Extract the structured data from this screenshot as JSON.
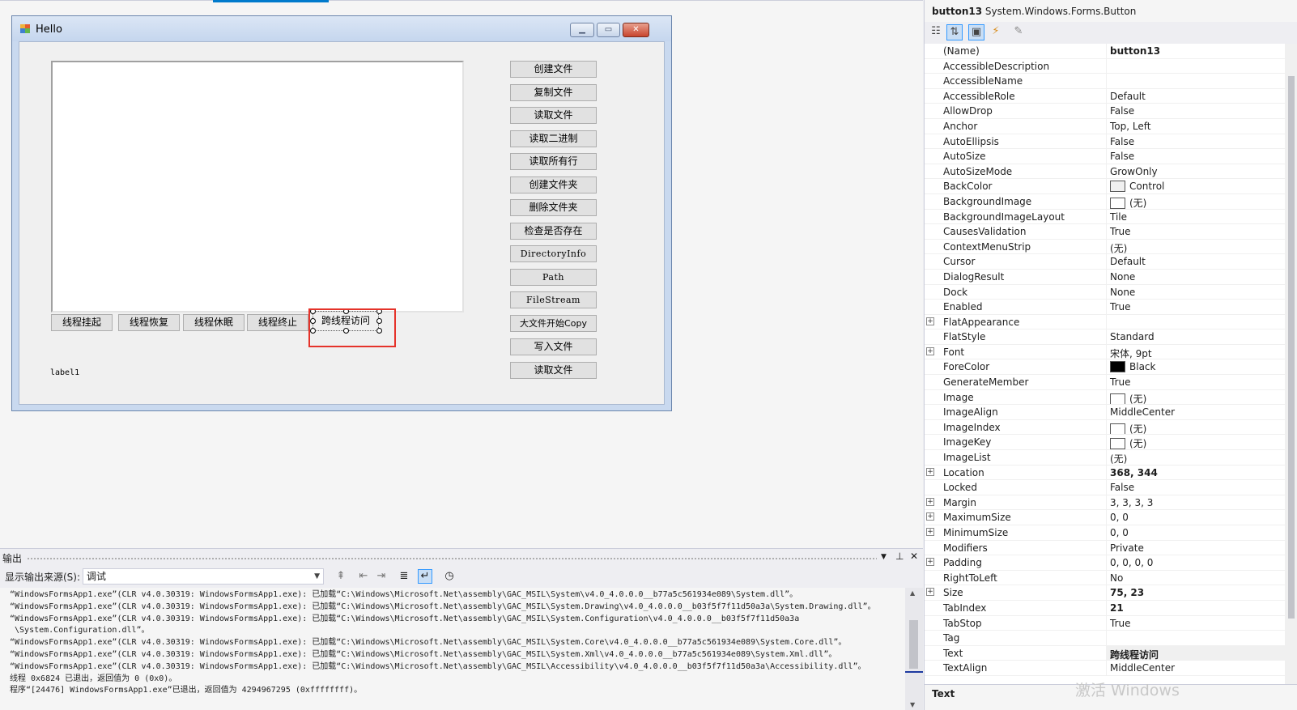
{
  "form": {
    "title": "Hello",
    "textbox_value": "",
    "right_buttons": [
      "创建文件",
      "复制文件",
      "读取文件",
      "读取二进制",
      "读取所有行",
      "创建文件夹",
      "删除文件夹",
      "检查是否存在",
      "DirectoryInfo",
      "Path",
      "FileStream",
      "大文件开始Copy",
      "写入文件",
      "读取文件"
    ],
    "bottom_buttons": [
      "线程挂起",
      "线程恢复",
      "线程休眠",
      "线程终止"
    ],
    "selected_button": "跨线程访问",
    "label": "label1"
  },
  "output": {
    "title": "输出",
    "source_label": "显示输出来源(S):",
    "source_value": "调试",
    "lines": [
      "“WindowsFormsApp1.exe”(CLR v4.0.30319: WindowsFormsApp1.exe): 已加载“C:\\Windows\\Microsoft.Net\\assembly\\GAC_MSIL\\System\\v4.0_4.0.0.0__b77a5c561934e089\\System.dll”。",
      "“WindowsFormsApp1.exe”(CLR v4.0.30319: WindowsFormsApp1.exe): 已加载“C:\\Windows\\Microsoft.Net\\assembly\\GAC_MSIL\\System.Drawing\\v4.0_4.0.0.0__b03f5f7f11d50a3a\\System.Drawing.dll”。",
      "“WindowsFormsApp1.exe”(CLR v4.0.30319: WindowsFormsApp1.exe): 已加载“C:\\Windows\\Microsoft.Net\\assembly\\GAC_MSIL\\System.Configuration\\v4.0_4.0.0.0__b03f5f7f11d50a3a",
      " \\System.Configuration.dll”。",
      "“WindowsFormsApp1.exe”(CLR v4.0.30319: WindowsFormsApp1.exe): 已加载“C:\\Windows\\Microsoft.Net\\assembly\\GAC_MSIL\\System.Core\\v4.0_4.0.0.0__b77a5c561934e089\\System.Core.dll”。",
      "“WindowsFormsApp1.exe”(CLR v4.0.30319: WindowsFormsApp1.exe): 已加载“C:\\Windows\\Microsoft.Net\\assembly\\GAC_MSIL\\System.Xml\\v4.0_4.0.0.0__b77a5c561934e089\\System.Xml.dll”。",
      "“WindowsFormsApp1.exe”(CLR v4.0.30319: WindowsFormsApp1.exe): 已加载“C:\\Windows\\Microsoft.Net\\assembly\\GAC_MSIL\\Accessibility\\v4.0_4.0.0.0__b03f5f7f11d50a3a\\Accessibility.dll”。",
      "线程 0x6824 已退出，返回值为 0 (0x0)。",
      "程序“[24476] WindowsFormsApp1.exe”已退出，返回值为 4294967295 (0xffffffff)。"
    ]
  },
  "properties": {
    "object_name": "button13",
    "object_type": "System.Windows.Forms.Button",
    "rows": [
      {
        "name": "(Name)",
        "value": "button13",
        "bold": true
      },
      {
        "name": "AccessibleDescription",
        "value": ""
      },
      {
        "name": "AccessibleName",
        "value": ""
      },
      {
        "name": "AccessibleRole",
        "value": "Default"
      },
      {
        "name": "AllowDrop",
        "value": "False"
      },
      {
        "name": "Anchor",
        "value": "Top, Left"
      },
      {
        "name": "AutoEllipsis",
        "value": "False"
      },
      {
        "name": "AutoSize",
        "value": "False"
      },
      {
        "name": "AutoSizeMode",
        "value": "GrowOnly"
      },
      {
        "name": "BackColor",
        "value": "Control",
        "swatch": "#f0f0f0"
      },
      {
        "name": "BackgroundImage",
        "value": "(无)",
        "swatch": "#ffffff"
      },
      {
        "name": "BackgroundImageLayout",
        "value": "Tile"
      },
      {
        "name": "CausesValidation",
        "value": "True"
      },
      {
        "name": "ContextMenuStrip",
        "value": "(无)"
      },
      {
        "name": "Cursor",
        "value": "Default"
      },
      {
        "name": "DialogResult",
        "value": "None"
      },
      {
        "name": "Dock",
        "value": "None"
      },
      {
        "name": "Enabled",
        "value": "True"
      },
      {
        "name": "FlatAppearance",
        "value": "",
        "expand": true
      },
      {
        "name": "FlatStyle",
        "value": "Standard"
      },
      {
        "name": "Font",
        "value": "宋体, 9pt",
        "expand": true
      },
      {
        "name": "ForeColor",
        "value": "Black",
        "swatch": "#000000"
      },
      {
        "name": "GenerateMember",
        "value": "True"
      },
      {
        "name": "Image",
        "value": "(无)",
        "swatch": "#ffffff"
      },
      {
        "name": "ImageAlign",
        "value": "MiddleCenter"
      },
      {
        "name": "ImageIndex",
        "value": "(无)",
        "swatch": "#ffffff"
      },
      {
        "name": "ImageKey",
        "value": "(无)",
        "swatch": "#ffffff"
      },
      {
        "name": "ImageList",
        "value": "(无)"
      },
      {
        "name": "Location",
        "value": "368, 344",
        "bold": true,
        "expand": true
      },
      {
        "name": "Locked",
        "value": "False"
      },
      {
        "name": "Margin",
        "value": "3, 3, 3, 3",
        "expand": true
      },
      {
        "name": "MaximumSize",
        "value": "0, 0",
        "expand": true
      },
      {
        "name": "MinimumSize",
        "value": "0, 0",
        "expand": true
      },
      {
        "name": "Modifiers",
        "value": "Private"
      },
      {
        "name": "Padding",
        "value": "0, 0, 0, 0",
        "expand": true
      },
      {
        "name": "RightToLeft",
        "value": "No"
      },
      {
        "name": "Size",
        "value": "75, 23",
        "bold": true,
        "expand": true
      },
      {
        "name": "TabIndex",
        "value": "21",
        "bold": true
      },
      {
        "name": "TabStop",
        "value": "True"
      },
      {
        "name": "Tag",
        "value": ""
      },
      {
        "name": "Text",
        "value": "跨线程访问",
        "bold": true,
        "selected": true
      },
      {
        "name": "TextAlign",
        "value": "MiddleCenter"
      }
    ],
    "description_title": "Text",
    "watermark": "激活 Windows"
  }
}
